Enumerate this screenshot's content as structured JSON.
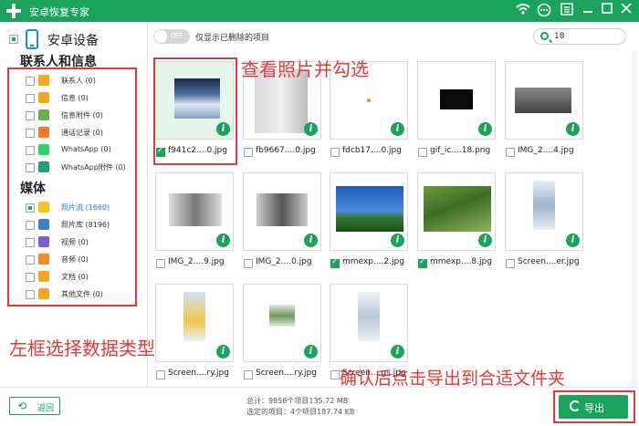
{
  "app": {
    "title": "安卓恢复专家"
  },
  "sidebar": {
    "device_label": "安卓设备",
    "section_contacts": "联系人和信息",
    "section_media": "媒体",
    "contacts_items": [
      {
        "label": "联系人 (0)",
        "icon": "contacts-icon",
        "color": "#f5a623"
      },
      {
        "label": "信息 (0)",
        "icon": "message-icon",
        "color": "#f5a623"
      },
      {
        "label": "信息附件 (0)",
        "icon": "attachment-icon",
        "color": "#6ab04c"
      },
      {
        "label": "通话记录 (0)",
        "icon": "phone-call-icon",
        "color": "#f07a2a"
      },
      {
        "label": "WhatsApp (0)",
        "icon": "whatsapp-icon",
        "color": "#25d366"
      },
      {
        "label": "WhatsApp附件 (0)",
        "icon": "whatsapp-attachment-icon",
        "color": "#1f9e7a"
      }
    ],
    "media_items": [
      {
        "label": "照片流 (1660)",
        "icon": "photo-stream-icon",
        "color": "#f5c518",
        "active": true
      },
      {
        "label": "照片库 (8196)",
        "icon": "photo-library-icon",
        "color": "#3b82c4"
      },
      {
        "label": "视频 (0)",
        "icon": "video-icon",
        "color": "#7b5cd6"
      },
      {
        "label": "音频 (0)",
        "icon": "audio-icon",
        "color": "#f08a24"
      },
      {
        "label": "文档 (0)",
        "icon": "document-icon",
        "color": "#f5a623"
      },
      {
        "label": "其他文件 (0)",
        "icon": "other-files-icon",
        "color": "#f5a623"
      }
    ]
  },
  "toolbar": {
    "toggle_label": "OFF",
    "toggle_text": "仅显示已删除的项目",
    "search_value": "18"
  },
  "grid": {
    "files": [
      {
        "name": "f941c2....0.jpg",
        "checked": true,
        "selected": true
      },
      {
        "name": "fb9667....0.jpg",
        "checked": false
      },
      {
        "name": "fdcb17....0.jpg",
        "checked": false
      },
      {
        "name": "gif_ic....18.png",
        "checked": false
      },
      {
        "name": "IMG_2....4.jpg",
        "checked": false
      },
      {
        "name": "IMG_2....9.jpg",
        "checked": false
      },
      {
        "name": "IMG_2....0.jpg",
        "checked": false
      },
      {
        "name": "mmexp....2.jpg",
        "checked": true
      },
      {
        "name": "mmexp....8.jpg",
        "checked": true
      },
      {
        "name": "Screen....er.jpg",
        "checked": false
      },
      {
        "name": "Screen....ry.jpg",
        "checked": false
      },
      {
        "name": "Screen....ry.jpg",
        "checked": false
      },
      {
        "name": "Screen....gs.jpg",
        "checked": false
      }
    ]
  },
  "annotations": {
    "view_photos": "查看照片并勾选",
    "left_frame": "左框选择数据类型",
    "confirm_export": "确认后点击导出到合适文件夹"
  },
  "bottom": {
    "back_label": "返回",
    "total": "总计：9856个项目135.72 MB",
    "selected": "选定的项目：4个项目187.74 KB",
    "export_label": "导出"
  },
  "colors": {
    "accent": "#1aa35c",
    "annotation": "#e03a3a",
    "link": "#1a7fd0"
  }
}
